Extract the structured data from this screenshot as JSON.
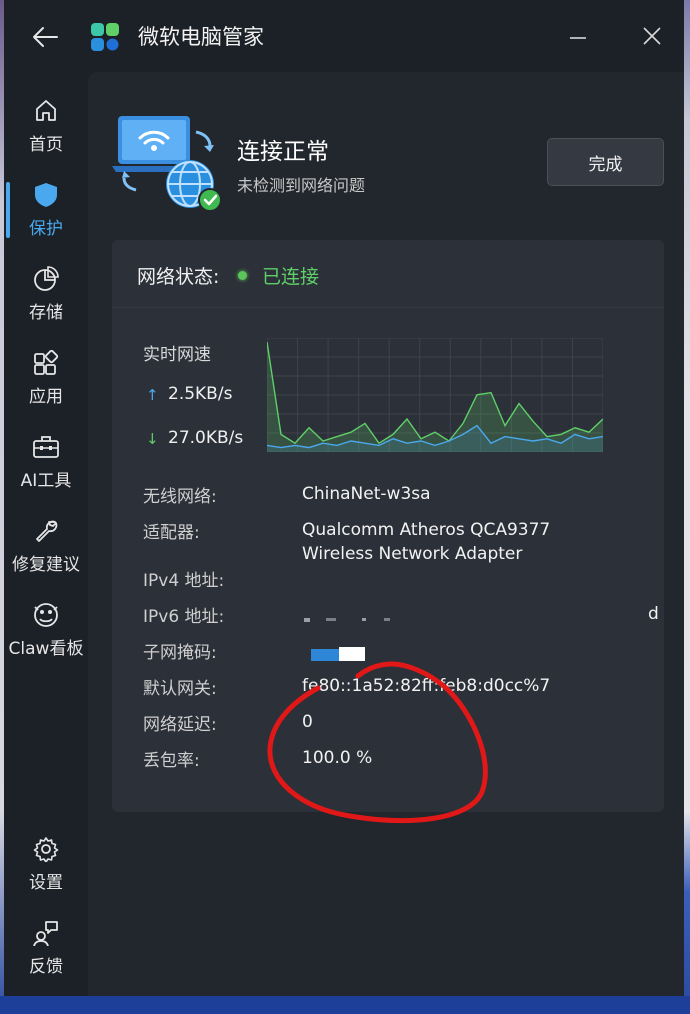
{
  "window": {
    "title": "微软电脑管家"
  },
  "sidebar": {
    "items": [
      {
        "label": "首页",
        "icon": "home-icon"
      },
      {
        "label": "保护",
        "icon": "shield-icon",
        "active": true
      },
      {
        "label": "存储",
        "icon": "pie-chart-icon"
      },
      {
        "label": "应用",
        "icon": "apps-icon"
      },
      {
        "label": "AI工具",
        "icon": "toolbox-icon"
      },
      {
        "label": "修复建议",
        "icon": "wrench-icon"
      },
      {
        "label": "Claw看板",
        "icon": "claw-icon"
      }
    ],
    "bottom_items": [
      {
        "label": "设置",
        "icon": "gear-icon"
      },
      {
        "label": "反馈",
        "icon": "feedback-icon"
      }
    ]
  },
  "status": {
    "title": "连接正常",
    "subtitle": "未检测到网络问题",
    "done_label": "完成"
  },
  "network": {
    "label": "网络状态:",
    "state": "已连接",
    "speed_label": "实时网速",
    "upload": "2.5KB/s",
    "download": "27.0KB/s",
    "rows": [
      {
        "key": "无线网络:",
        "value": "ChinaNet-w3sa"
      },
      {
        "key": "适配器:",
        "value": "Qualcomm Atheros QCA9377",
        "value2": "Wireless Network Adapter"
      },
      {
        "key": "IPv4 地址:",
        "value": ""
      },
      {
        "key": "IPv6 地址:",
        "value": "d"
      },
      {
        "key": "子网掩码:",
        "value": ""
      },
      {
        "key": "默认网关:",
        "value": "fe80::1a52:82ff:feb8:d0cc%7"
      },
      {
        "key": "网络延迟:",
        "value": "0"
      },
      {
        "key": "丢包率:",
        "value": "100.0 %"
      }
    ]
  },
  "chart_data": {
    "type": "area",
    "series": [
      {
        "values": [
          100,
          16,
          8,
          22,
          10,
          14,
          18,
          26,
          8,
          16,
          30,
          12,
          18,
          10,
          26,
          52,
          54,
          24,
          44,
          28,
          14,
          16,
          22,
          18,
          30
        ],
        "color": "#5fcf68"
      },
      {
        "values": [
          6,
          4,
          6,
          4,
          8,
          6,
          10,
          8,
          6,
          12,
          8,
          10,
          6,
          10,
          16,
          24,
          8,
          14,
          12,
          10,
          12,
          8,
          16,
          12,
          14
        ],
        "color": "#4aa8ee"
      }
    ],
    "grid": true
  },
  "colors": {
    "accent": "#4aa8ee",
    "success": "#5fcf68",
    "annotation": "#e01818"
  }
}
